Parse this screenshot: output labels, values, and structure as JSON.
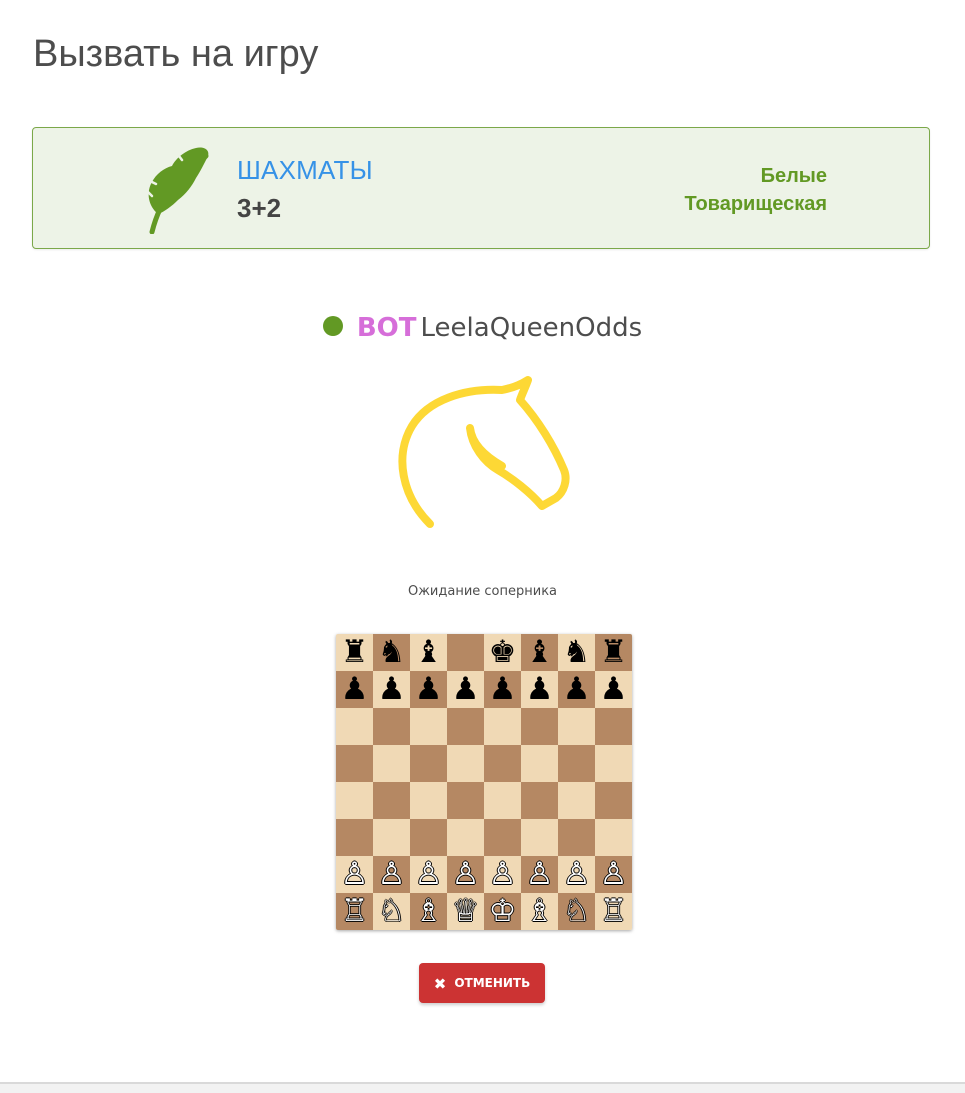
{
  "page": {
    "title": "Вызвать на игру"
  },
  "setup": {
    "variant_icon": "feather-icon",
    "variant_name": "ШАХМАТЫ",
    "time_control": "3+2",
    "color": "Белые",
    "mode": "Товарищеская",
    "colors": {
      "accent_green": "#629924",
      "box_background": "#edf3e7",
      "variant_blue": "#3692e7"
    }
  },
  "opponent": {
    "status": "online",
    "title": "BOT",
    "name": "LeelaQueenOdds",
    "colors": {
      "online": "#629924",
      "bot_title": "#d66ed9"
    }
  },
  "waiting": {
    "icon": "knight-spinner-icon",
    "text": "Ожидание соперника"
  },
  "board": {
    "rows": [
      [
        "♜",
        "♞",
        "♝",
        "",
        "♚",
        "♝",
        "♞",
        "♜"
      ],
      [
        "♟",
        "♟",
        "♟",
        "♟",
        "♟",
        "♟",
        "♟",
        "♟"
      ],
      [
        "",
        "",
        "",
        "",
        "",
        "",
        "",
        ""
      ],
      [
        "",
        "",
        "",
        "",
        "",
        "",
        "",
        ""
      ],
      [
        "",
        "",
        "",
        "",
        "",
        "",
        "",
        ""
      ],
      [
        "",
        "",
        "",
        "",
        "",
        "",
        "",
        ""
      ],
      [
        "♙",
        "♙",
        "♙",
        "♙",
        "♙",
        "♙",
        "♙",
        "♙"
      ],
      [
        "♖",
        "♘",
        "♗",
        "♕",
        "♔",
        "♗",
        "♘",
        "♖"
      ]
    ],
    "colors": {
      "light": "#f0d9b5",
      "dark": "#b58863"
    }
  },
  "actions": {
    "cancel_icon": "close-icon",
    "cancel_label": "ОТМЕНИТЬ",
    "cancel_color": "#cc3333"
  }
}
